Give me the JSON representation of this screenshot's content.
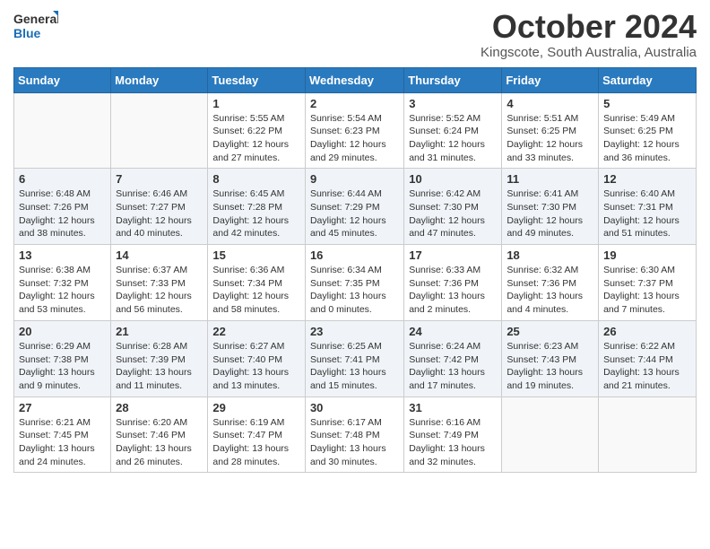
{
  "logo": {
    "line1": "General",
    "line2": "Blue"
  },
  "title": "October 2024",
  "subtitle": "Kingscote, South Australia, Australia",
  "headers": [
    "Sunday",
    "Monday",
    "Tuesday",
    "Wednesday",
    "Thursday",
    "Friday",
    "Saturday"
  ],
  "weeks": [
    [
      {
        "day": "",
        "info": ""
      },
      {
        "day": "",
        "info": ""
      },
      {
        "day": "1",
        "info": "Sunrise: 5:55 AM\nSunset: 6:22 PM\nDaylight: 12 hours and 27 minutes."
      },
      {
        "day": "2",
        "info": "Sunrise: 5:54 AM\nSunset: 6:23 PM\nDaylight: 12 hours and 29 minutes."
      },
      {
        "day": "3",
        "info": "Sunrise: 5:52 AM\nSunset: 6:24 PM\nDaylight: 12 hours and 31 minutes."
      },
      {
        "day": "4",
        "info": "Sunrise: 5:51 AM\nSunset: 6:25 PM\nDaylight: 12 hours and 33 minutes."
      },
      {
        "day": "5",
        "info": "Sunrise: 5:49 AM\nSunset: 6:25 PM\nDaylight: 12 hours and 36 minutes."
      }
    ],
    [
      {
        "day": "6",
        "info": "Sunrise: 6:48 AM\nSunset: 7:26 PM\nDaylight: 12 hours and 38 minutes."
      },
      {
        "day": "7",
        "info": "Sunrise: 6:46 AM\nSunset: 7:27 PM\nDaylight: 12 hours and 40 minutes."
      },
      {
        "day": "8",
        "info": "Sunrise: 6:45 AM\nSunset: 7:28 PM\nDaylight: 12 hours and 42 minutes."
      },
      {
        "day": "9",
        "info": "Sunrise: 6:44 AM\nSunset: 7:29 PM\nDaylight: 12 hours and 45 minutes."
      },
      {
        "day": "10",
        "info": "Sunrise: 6:42 AM\nSunset: 7:30 PM\nDaylight: 12 hours and 47 minutes."
      },
      {
        "day": "11",
        "info": "Sunrise: 6:41 AM\nSunset: 7:30 PM\nDaylight: 12 hours and 49 minutes."
      },
      {
        "day": "12",
        "info": "Sunrise: 6:40 AM\nSunset: 7:31 PM\nDaylight: 12 hours and 51 minutes."
      }
    ],
    [
      {
        "day": "13",
        "info": "Sunrise: 6:38 AM\nSunset: 7:32 PM\nDaylight: 12 hours and 53 minutes."
      },
      {
        "day": "14",
        "info": "Sunrise: 6:37 AM\nSunset: 7:33 PM\nDaylight: 12 hours and 56 minutes."
      },
      {
        "day": "15",
        "info": "Sunrise: 6:36 AM\nSunset: 7:34 PM\nDaylight: 12 hours and 58 minutes."
      },
      {
        "day": "16",
        "info": "Sunrise: 6:34 AM\nSunset: 7:35 PM\nDaylight: 13 hours and 0 minutes."
      },
      {
        "day": "17",
        "info": "Sunrise: 6:33 AM\nSunset: 7:36 PM\nDaylight: 13 hours and 2 minutes."
      },
      {
        "day": "18",
        "info": "Sunrise: 6:32 AM\nSunset: 7:36 PM\nDaylight: 13 hours and 4 minutes."
      },
      {
        "day": "19",
        "info": "Sunrise: 6:30 AM\nSunset: 7:37 PM\nDaylight: 13 hours and 7 minutes."
      }
    ],
    [
      {
        "day": "20",
        "info": "Sunrise: 6:29 AM\nSunset: 7:38 PM\nDaylight: 13 hours and 9 minutes."
      },
      {
        "day": "21",
        "info": "Sunrise: 6:28 AM\nSunset: 7:39 PM\nDaylight: 13 hours and 11 minutes."
      },
      {
        "day": "22",
        "info": "Sunrise: 6:27 AM\nSunset: 7:40 PM\nDaylight: 13 hours and 13 minutes."
      },
      {
        "day": "23",
        "info": "Sunrise: 6:25 AM\nSunset: 7:41 PM\nDaylight: 13 hours and 15 minutes."
      },
      {
        "day": "24",
        "info": "Sunrise: 6:24 AM\nSunset: 7:42 PM\nDaylight: 13 hours and 17 minutes."
      },
      {
        "day": "25",
        "info": "Sunrise: 6:23 AM\nSunset: 7:43 PM\nDaylight: 13 hours and 19 minutes."
      },
      {
        "day": "26",
        "info": "Sunrise: 6:22 AM\nSunset: 7:44 PM\nDaylight: 13 hours and 21 minutes."
      }
    ],
    [
      {
        "day": "27",
        "info": "Sunrise: 6:21 AM\nSunset: 7:45 PM\nDaylight: 13 hours and 24 minutes."
      },
      {
        "day": "28",
        "info": "Sunrise: 6:20 AM\nSunset: 7:46 PM\nDaylight: 13 hours and 26 minutes."
      },
      {
        "day": "29",
        "info": "Sunrise: 6:19 AM\nSunset: 7:47 PM\nDaylight: 13 hours and 28 minutes."
      },
      {
        "day": "30",
        "info": "Sunrise: 6:17 AM\nSunset: 7:48 PM\nDaylight: 13 hours and 30 minutes."
      },
      {
        "day": "31",
        "info": "Sunrise: 6:16 AM\nSunset: 7:49 PM\nDaylight: 13 hours and 32 minutes."
      },
      {
        "day": "",
        "info": ""
      },
      {
        "day": "",
        "info": ""
      }
    ]
  ]
}
